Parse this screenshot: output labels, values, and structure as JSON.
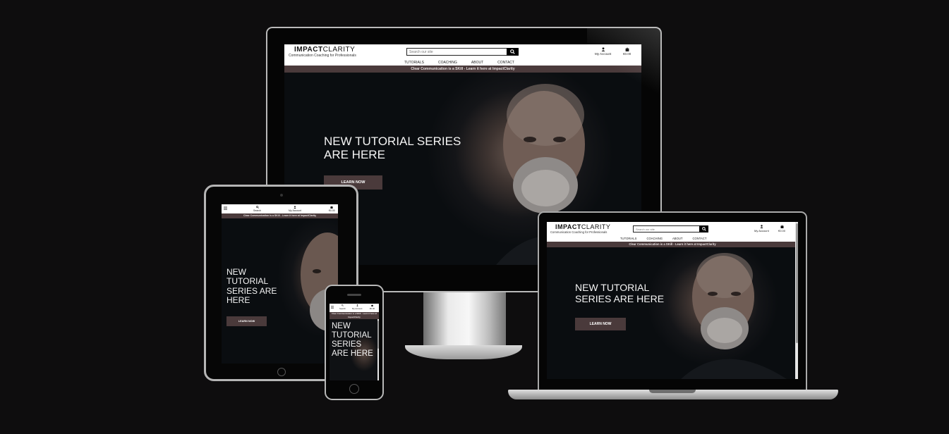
{
  "brand": {
    "logo_bold": "IMPACT",
    "logo_thin": "CLARITY",
    "tagline": "Communication Coaching for Professionals"
  },
  "search": {
    "placeholder": "Search our site",
    "icon": "search-icon"
  },
  "nav": [
    "TUTORIALS",
    "COACHING",
    "ABOUT",
    "CONTACT"
  ],
  "account": {
    "label": "My Account",
    "icon": "user-icon"
  },
  "bag": {
    "amount": "€0.00",
    "icon": "shopping-bag-icon"
  },
  "banner": "Clear Communication is a SKill - Learn it here at ImpactClarity",
  "hero": {
    "title": "NEW TUTORIAL SERIES ARE HERE",
    "cta": "LEARN NOW"
  },
  "mobile_header": {
    "menu_icon": "hamburger-icon",
    "search_label": "Search",
    "account_label": "My Account",
    "bag_amount": "€0.00"
  },
  "colors": {
    "banner": "#4a3a3b",
    "cta": "#4a3a3b",
    "background": "#0e0d0e"
  }
}
